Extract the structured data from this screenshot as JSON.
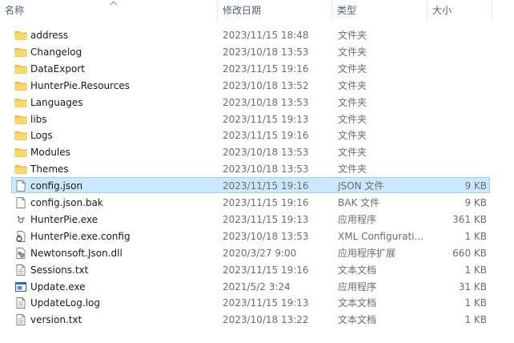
{
  "columns": {
    "name": "名称",
    "date": "修改日期",
    "type": "类型",
    "size": "大小"
  },
  "files": [
    {
      "name": "address",
      "date": "2023/11/15 18:48",
      "type": "文件夹",
      "size": "",
      "icon": "folder-icon"
    },
    {
      "name": "Changelog",
      "date": "2023/10/18 13:53",
      "type": "文件夹",
      "size": "",
      "icon": "folder-icon"
    },
    {
      "name": "DataExport",
      "date": "2023/11/15 19:16",
      "type": "文件夹",
      "size": "",
      "icon": "folder-icon"
    },
    {
      "name": "HunterPie.Resources",
      "date": "2023/10/18 13:52",
      "type": "文件夹",
      "size": "",
      "icon": "folder-icon"
    },
    {
      "name": "Languages",
      "date": "2023/10/18 13:53",
      "type": "文件夹",
      "size": "",
      "icon": "folder-icon"
    },
    {
      "name": "libs",
      "date": "2023/11/15 19:13",
      "type": "文件夹",
      "size": "",
      "icon": "folder-icon"
    },
    {
      "name": "Logs",
      "date": "2023/11/15 19:16",
      "type": "文件夹",
      "size": "",
      "icon": "folder-icon"
    },
    {
      "name": "Modules",
      "date": "2023/10/18 13:53",
      "type": "文件夹",
      "size": "",
      "icon": "folder-icon"
    },
    {
      "name": "Themes",
      "date": "2023/10/18 13:53",
      "type": "文件夹",
      "size": "",
      "icon": "folder-icon"
    },
    {
      "name": "config.json",
      "date": "2023/11/15 19:16",
      "type": "JSON 文件",
      "size": "9 KB",
      "icon": "document-icon",
      "selected": true
    },
    {
      "name": "config.json.bak",
      "date": "2023/11/15 19:16",
      "type": "BAK 文件",
      "size": "9 KB",
      "icon": "document-icon"
    },
    {
      "name": "HunterPie.exe",
      "date": "2023/11/15 19:13",
      "type": "应用程序",
      "size": "361 KB",
      "icon": "app-exe-icon"
    },
    {
      "name": "HunterPie.exe.config",
      "date": "2023/10/18 13:53",
      "type": "XML Configurati...",
      "size": "1 KB",
      "icon": "config-file-icon"
    },
    {
      "name": "Newtonsoft.Json.dll",
      "date": "2020/3/27 9:00",
      "type": "应用程序扩展",
      "size": "660 KB",
      "icon": "dll-file-icon"
    },
    {
      "name": "Sessions.txt",
      "date": "2023/11/15 19:16",
      "type": "文本文档",
      "size": "1 KB",
      "icon": "text-file-icon"
    },
    {
      "name": "Update.exe",
      "date": "2021/5/2 3:24",
      "type": "应用程序",
      "size": "31 KB",
      "icon": "window-exe-icon"
    },
    {
      "name": "UpdateLog.log",
      "date": "2023/11/15 19:13",
      "type": "文本文档",
      "size": "1 KB",
      "icon": "text-file-icon"
    },
    {
      "name": "version.txt",
      "date": "2023/10/18 13:22",
      "type": "文本文档",
      "size": "1 KB",
      "icon": "text-file-icon"
    }
  ],
  "colors": {
    "selection_bg": "#cce8ff",
    "selection_border": "#99d1ff",
    "folder": "#f7c94b",
    "header_text": "#4c607a"
  }
}
